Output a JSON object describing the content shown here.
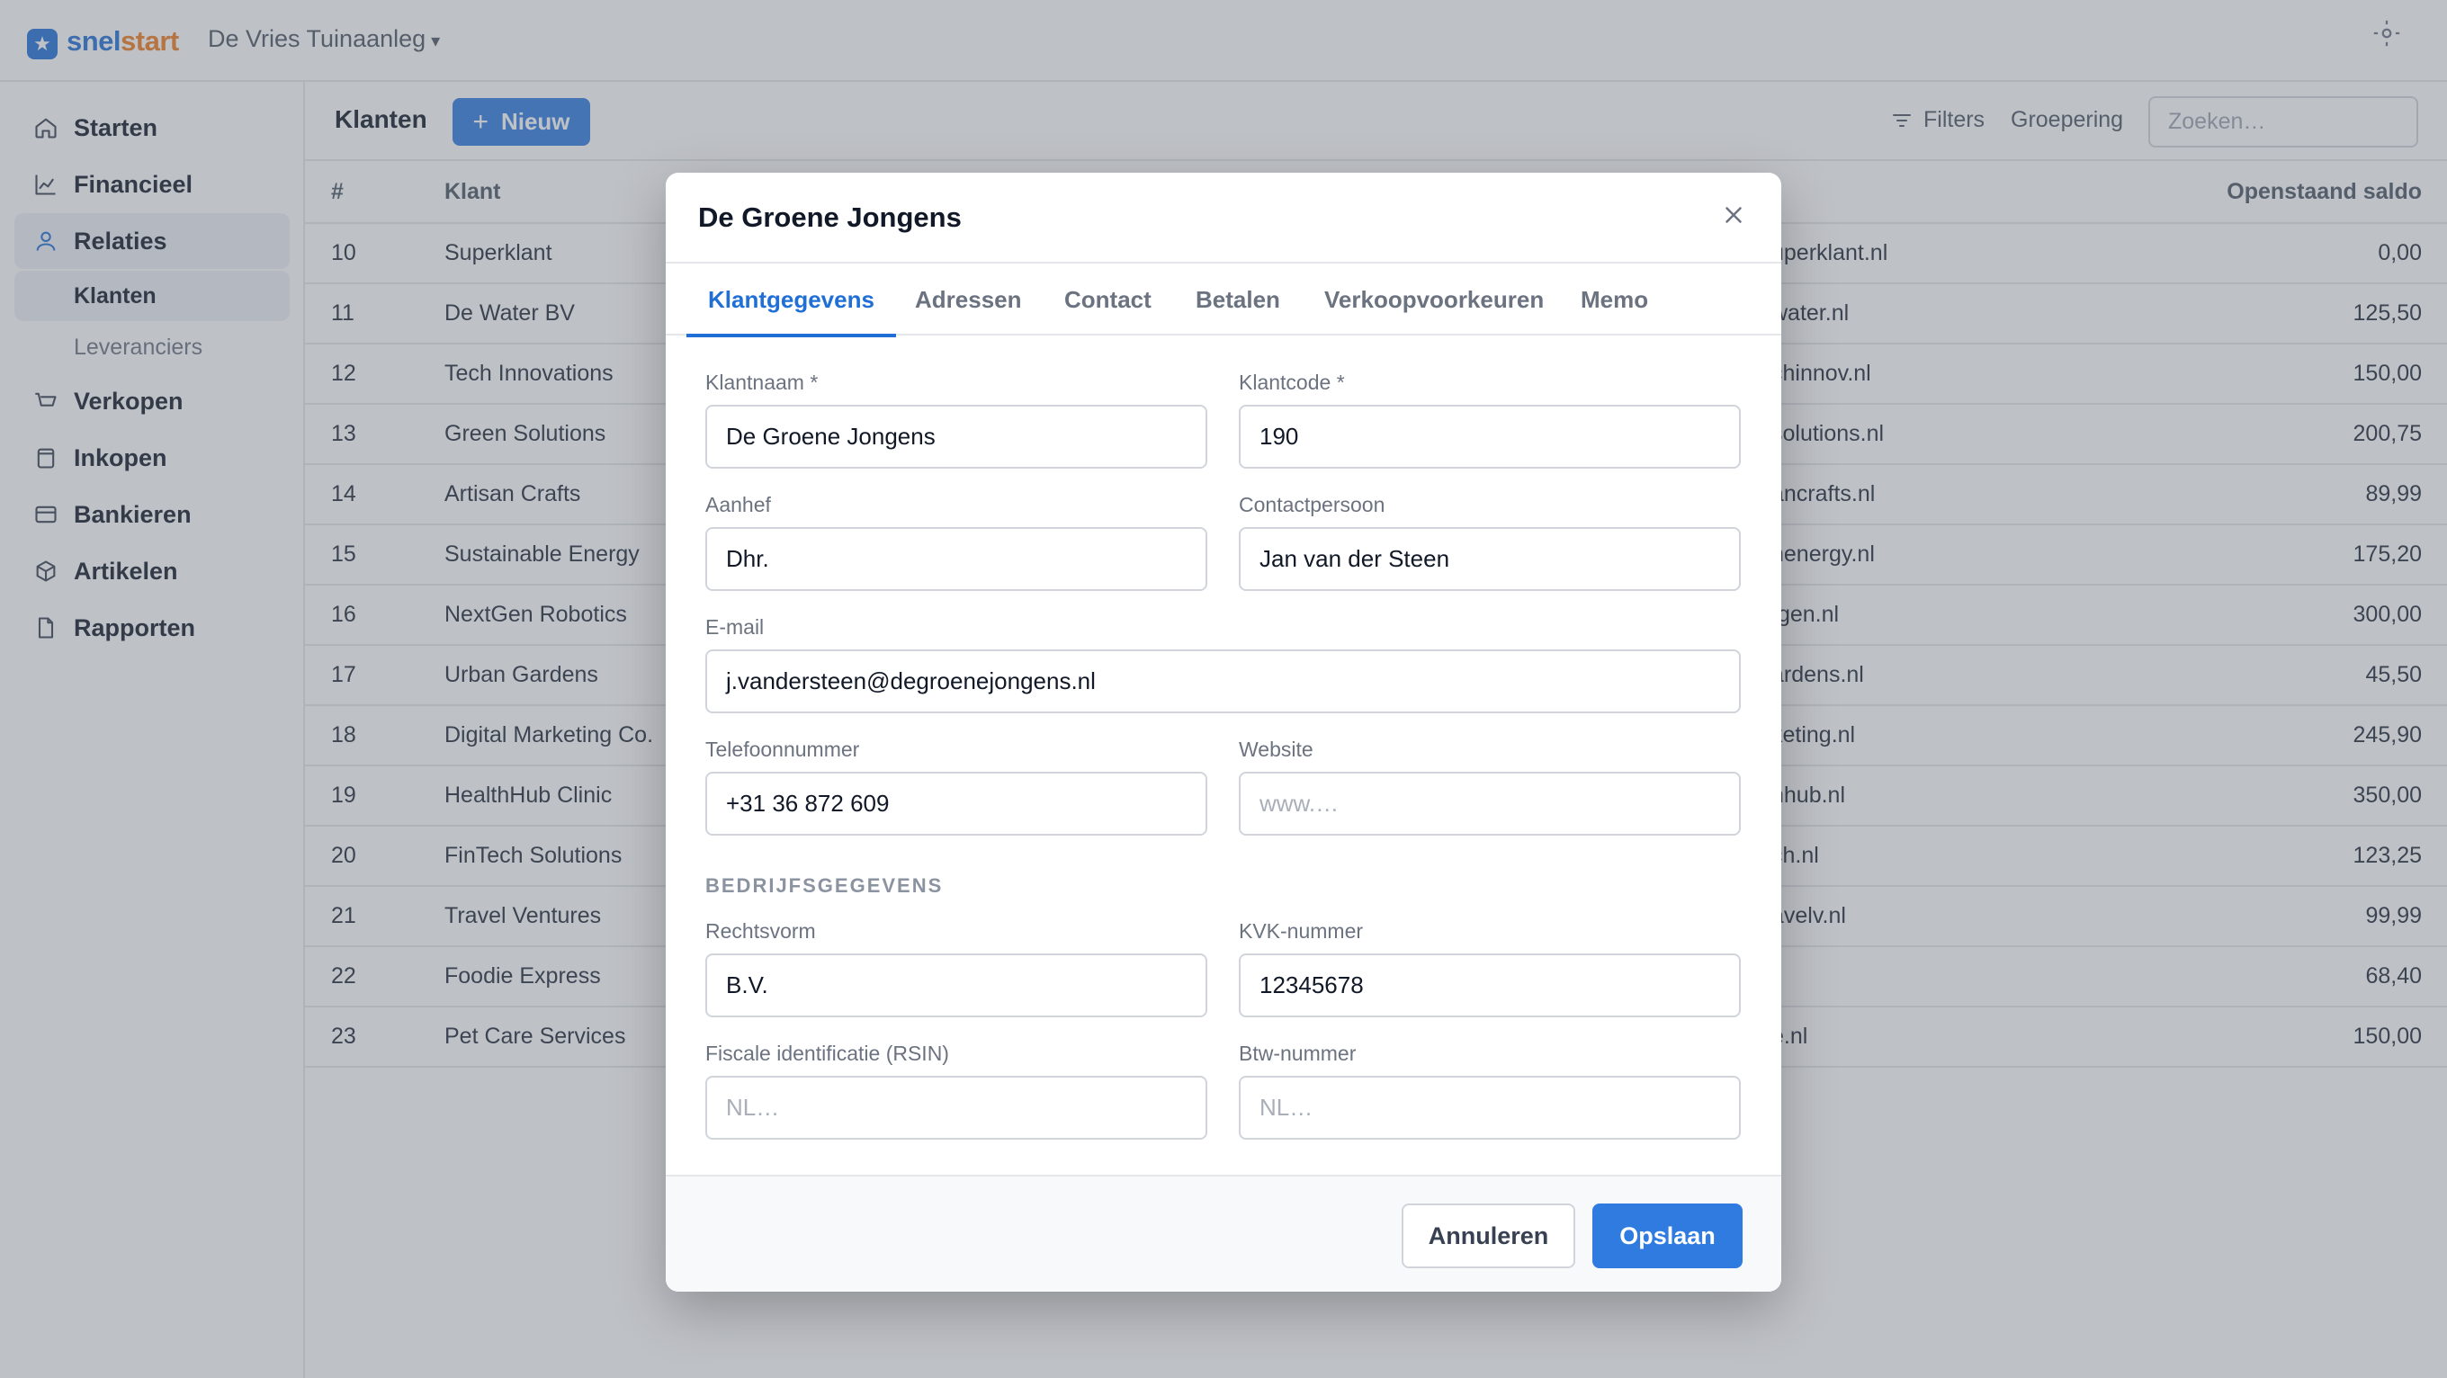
{
  "app": {
    "brand_snel": "snel",
    "brand_start": "start",
    "company": "De Vries Tuinaanleg",
    "company_caret": "▾",
    "accent_color": "#1f6fd6",
    "brand_orange": "#f07b1d"
  },
  "sidebar": {
    "items": [
      {
        "label": "Starten",
        "icon": "home-icon"
      },
      {
        "label": "Financieel",
        "icon": "chart-line-icon"
      },
      {
        "label": "Relaties",
        "icon": "user-icon"
      },
      {
        "label": "Verkopen",
        "icon": "basket-icon"
      },
      {
        "label": "Inkopen",
        "icon": "bag-icon"
      },
      {
        "label": "Bankieren",
        "icon": "credit-card-icon"
      },
      {
        "label": "Artikelen",
        "icon": "box-icon"
      },
      {
        "label": "Rapporten",
        "icon": "document-icon"
      }
    ],
    "sub_items": [
      {
        "label": "Klanten",
        "active": true
      },
      {
        "label": "Leveranciers",
        "active": false
      }
    ]
  },
  "toolbar": {
    "title": "Klanten",
    "new_label": "Nieuw",
    "filters_label": "Filters",
    "grouping_label": "Groepering",
    "search_placeholder": "Zoeken…"
  },
  "table": {
    "columns": {
      "number": "#",
      "name": "Klant",
      "balance": "Openstaand saldo"
    },
    "rows": [
      {
        "number": "10",
        "name": "Superklant",
        "email": "uperklant.nl",
        "balance": "0,00"
      },
      {
        "number": "11",
        "name": "De Water BV",
        "email": "water.nl",
        "balance": "125,50"
      },
      {
        "number": "12",
        "name": "Tech Innovations",
        "email": "chinnov.nl",
        "balance": "150,00"
      },
      {
        "number": "13",
        "name": "Green Solutions",
        "email": "solutions.nl",
        "balance": "200,75"
      },
      {
        "number": "14",
        "name": "Artisan Crafts",
        "email": "ancrafts.nl",
        "balance": "89,99"
      },
      {
        "number": "15",
        "name": "Sustainable Energy",
        "email": "nenergy.nl",
        "balance": "175,20"
      },
      {
        "number": "16",
        "name": "NextGen Robotics",
        "email": "tgen.nl",
        "balance": "300,00"
      },
      {
        "number": "17",
        "name": "Urban Gardens",
        "email": "ardens.nl",
        "balance": "45,50"
      },
      {
        "number": "18",
        "name": "Digital Marketing Co.",
        "email": "keting.nl",
        "balance": "245,90"
      },
      {
        "number": "19",
        "name": "HealthHub Clinic",
        "email": "hhub.nl",
        "balance": "350,00"
      },
      {
        "number": "20",
        "name": "FinTech Solutions",
        "email": "ch.nl",
        "balance": "123,25"
      },
      {
        "number": "21",
        "name": "Travel Ventures",
        "email": "avelv.nl",
        "balance": "99,99"
      },
      {
        "number": "22",
        "name": "Foodie Express",
        "email": "l",
        "balance": "68,40"
      },
      {
        "number": "23",
        "name": "Pet Care Services",
        "email": "e.nl",
        "balance": "150,00"
      }
    ]
  },
  "modal": {
    "title": "De Groene Jongens",
    "tabs": [
      "Klantgegevens",
      "Adressen",
      "Contact",
      "Betalen",
      "Verkoopvoorkeuren",
      "Memo"
    ],
    "active_tab": "Klantgegevens",
    "fields": {
      "klantnaam": {
        "label": "Klantnaam *",
        "value": "De Groene Jongens"
      },
      "klantcode": {
        "label": "Klantcode *",
        "value": "190"
      },
      "aanhef": {
        "label": "Aanhef",
        "value": "Dhr."
      },
      "contactpersoon": {
        "label": "Contactpersoon",
        "value": "Jan van der Steen"
      },
      "email": {
        "label": "E-mail",
        "value": "j.vandersteen@degroenejongens.nl"
      },
      "telefoon": {
        "label": "Telefoonnummer",
        "value": "+31 36 872 609"
      },
      "website": {
        "label": "Website",
        "placeholder": "www.…"
      },
      "rechtsvorm": {
        "label": "Rechtsvorm",
        "value": "B.V."
      },
      "kvk": {
        "label": "KVK-nummer",
        "value": "12345678"
      },
      "rsin": {
        "label": "Fiscale identificatie (RSIN)",
        "placeholder": "NL…"
      },
      "btw": {
        "label": "Btw-nummer",
        "placeholder": "NL…"
      }
    },
    "section_company": "BEDRIJFSGEGEVENS",
    "cancel_label": "Annuleren",
    "save_label": "Opslaan"
  }
}
